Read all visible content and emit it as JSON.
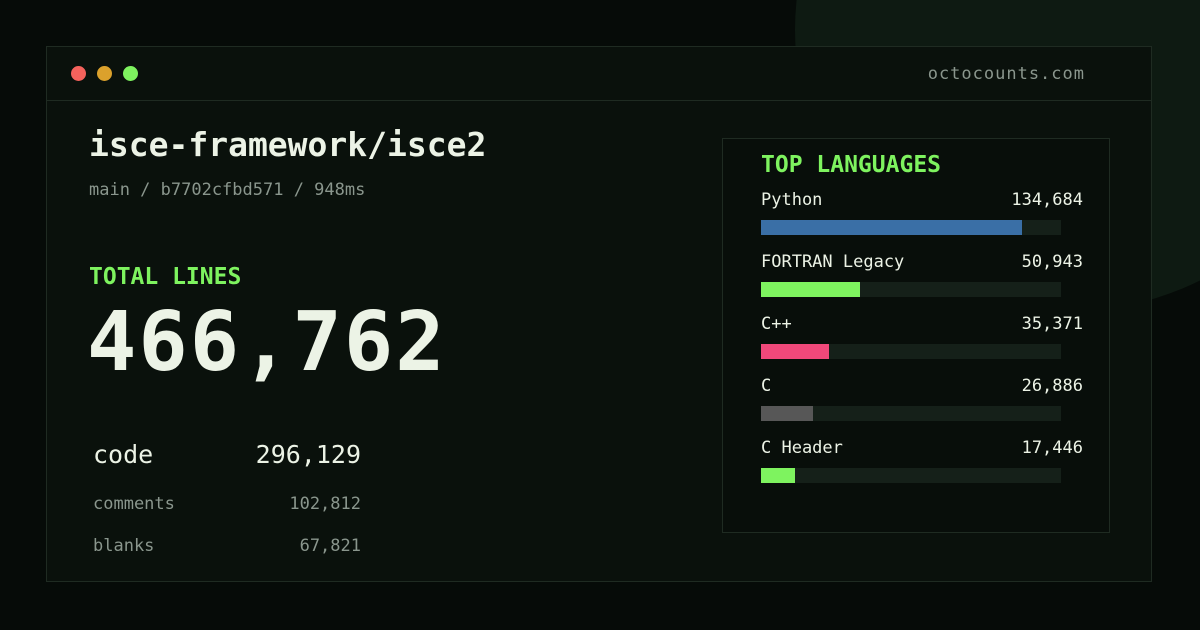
{
  "window": {
    "domain": "octocounts.com"
  },
  "repo": {
    "name": "isce-framework/isce2",
    "meta": "main / b7702cfbd571 / 948ms"
  },
  "totals": {
    "label": "TOTAL LINES",
    "value": "466,762"
  },
  "breakdown": [
    {
      "label": "code",
      "value": "296,129"
    },
    {
      "label": "comments",
      "value": "102,812"
    },
    {
      "label": "blanks",
      "value": "67,821"
    }
  ],
  "languages": {
    "title": "TOP LANGUAGES",
    "max": 155000,
    "items": [
      {
        "name": "Python",
        "count": "134,684",
        "value": 134684,
        "color": "#3a6fa6"
      },
      {
        "name": "FORTRAN Legacy",
        "count": "50,943",
        "value": 50943,
        "color": "#7ef35f"
      },
      {
        "name": "C++",
        "count": "35,371",
        "value": 35371,
        "color": "#f0487a"
      },
      {
        "name": "C",
        "count": "26,886",
        "value": 26886,
        "color": "#575757"
      },
      {
        "name": "C Header",
        "count": "17,446",
        "value": 17446,
        "color": "#7ef35f"
      }
    ]
  }
}
